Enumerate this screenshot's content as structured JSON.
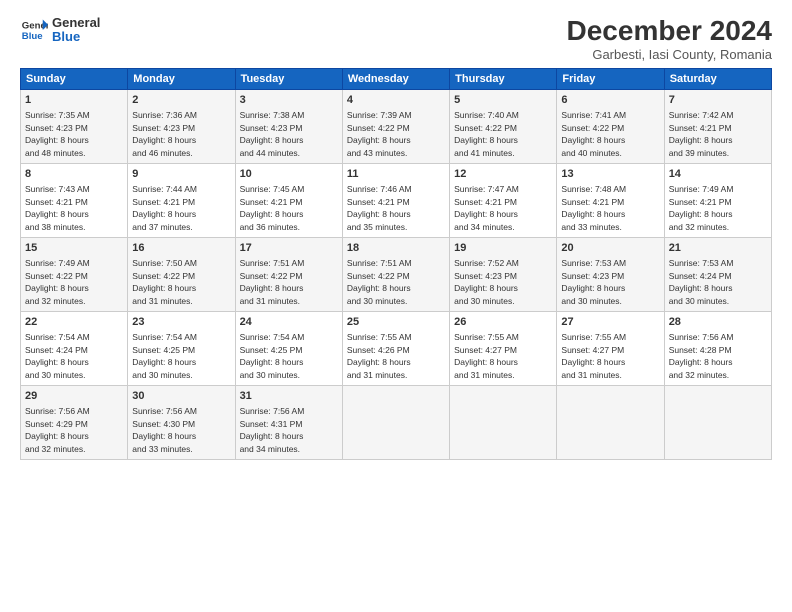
{
  "logo": {
    "line1": "General",
    "line2": "Blue"
  },
  "title": "December 2024",
  "subtitle": "Garbesti, Iasi County, Romania",
  "days_of_week": [
    "Sunday",
    "Monday",
    "Tuesday",
    "Wednesday",
    "Thursday",
    "Friday",
    "Saturday"
  ],
  "weeks": [
    [
      {
        "day": "1",
        "sunrise": "7:35 AM",
        "sunset": "4:23 PM",
        "daylight": "8 hours and 48 minutes."
      },
      {
        "day": "2",
        "sunrise": "7:36 AM",
        "sunset": "4:23 PM",
        "daylight": "8 hours and 46 minutes."
      },
      {
        "day": "3",
        "sunrise": "7:38 AM",
        "sunset": "4:23 PM",
        "daylight": "8 hours and 44 minutes."
      },
      {
        "day": "4",
        "sunrise": "7:39 AM",
        "sunset": "4:22 PM",
        "daylight": "8 hours and 43 minutes."
      },
      {
        "day": "5",
        "sunrise": "7:40 AM",
        "sunset": "4:22 PM",
        "daylight": "8 hours and 41 minutes."
      },
      {
        "day": "6",
        "sunrise": "7:41 AM",
        "sunset": "4:22 PM",
        "daylight": "8 hours and 40 minutes."
      },
      {
        "day": "7",
        "sunrise": "7:42 AM",
        "sunset": "4:21 PM",
        "daylight": "8 hours and 39 minutes."
      }
    ],
    [
      {
        "day": "8",
        "sunrise": "7:43 AM",
        "sunset": "4:21 PM",
        "daylight": "8 hours and 38 minutes."
      },
      {
        "day": "9",
        "sunrise": "7:44 AM",
        "sunset": "4:21 PM",
        "daylight": "8 hours and 37 minutes."
      },
      {
        "day": "10",
        "sunrise": "7:45 AM",
        "sunset": "4:21 PM",
        "daylight": "8 hours and 36 minutes."
      },
      {
        "day": "11",
        "sunrise": "7:46 AM",
        "sunset": "4:21 PM",
        "daylight": "8 hours and 35 minutes."
      },
      {
        "day": "12",
        "sunrise": "7:47 AM",
        "sunset": "4:21 PM",
        "daylight": "8 hours and 34 minutes."
      },
      {
        "day": "13",
        "sunrise": "7:48 AM",
        "sunset": "4:21 PM",
        "daylight": "8 hours and 33 minutes."
      },
      {
        "day": "14",
        "sunrise": "7:49 AM",
        "sunset": "4:21 PM",
        "daylight": "8 hours and 32 minutes."
      }
    ],
    [
      {
        "day": "15",
        "sunrise": "7:49 AM",
        "sunset": "4:22 PM",
        "daylight": "8 hours and 32 minutes."
      },
      {
        "day": "16",
        "sunrise": "7:50 AM",
        "sunset": "4:22 PM",
        "daylight": "8 hours and 31 minutes."
      },
      {
        "day": "17",
        "sunrise": "7:51 AM",
        "sunset": "4:22 PM",
        "daylight": "8 hours and 31 minutes."
      },
      {
        "day": "18",
        "sunrise": "7:51 AM",
        "sunset": "4:22 PM",
        "daylight": "8 hours and 30 minutes."
      },
      {
        "day": "19",
        "sunrise": "7:52 AM",
        "sunset": "4:23 PM",
        "daylight": "8 hours and 30 minutes."
      },
      {
        "day": "20",
        "sunrise": "7:53 AM",
        "sunset": "4:23 PM",
        "daylight": "8 hours and 30 minutes."
      },
      {
        "day": "21",
        "sunrise": "7:53 AM",
        "sunset": "4:24 PM",
        "daylight": "8 hours and 30 minutes."
      }
    ],
    [
      {
        "day": "22",
        "sunrise": "7:54 AM",
        "sunset": "4:24 PM",
        "daylight": "8 hours and 30 minutes."
      },
      {
        "day": "23",
        "sunrise": "7:54 AM",
        "sunset": "4:25 PM",
        "daylight": "8 hours and 30 minutes."
      },
      {
        "day": "24",
        "sunrise": "7:54 AM",
        "sunset": "4:25 PM",
        "daylight": "8 hours and 30 minutes."
      },
      {
        "day": "25",
        "sunrise": "7:55 AM",
        "sunset": "4:26 PM",
        "daylight": "8 hours and 31 minutes."
      },
      {
        "day": "26",
        "sunrise": "7:55 AM",
        "sunset": "4:27 PM",
        "daylight": "8 hours and 31 minutes."
      },
      {
        "day": "27",
        "sunrise": "7:55 AM",
        "sunset": "4:27 PM",
        "daylight": "8 hours and 31 minutes."
      },
      {
        "day": "28",
        "sunrise": "7:56 AM",
        "sunset": "4:28 PM",
        "daylight": "8 hours and 32 minutes."
      }
    ],
    [
      {
        "day": "29",
        "sunrise": "7:56 AM",
        "sunset": "4:29 PM",
        "daylight": "8 hours and 32 minutes."
      },
      {
        "day": "30",
        "sunrise": "7:56 AM",
        "sunset": "4:30 PM",
        "daylight": "8 hours and 33 minutes."
      },
      {
        "day": "31",
        "sunrise": "7:56 AM",
        "sunset": "4:31 PM",
        "daylight": "8 hours and 34 minutes."
      },
      null,
      null,
      null,
      null
    ]
  ]
}
